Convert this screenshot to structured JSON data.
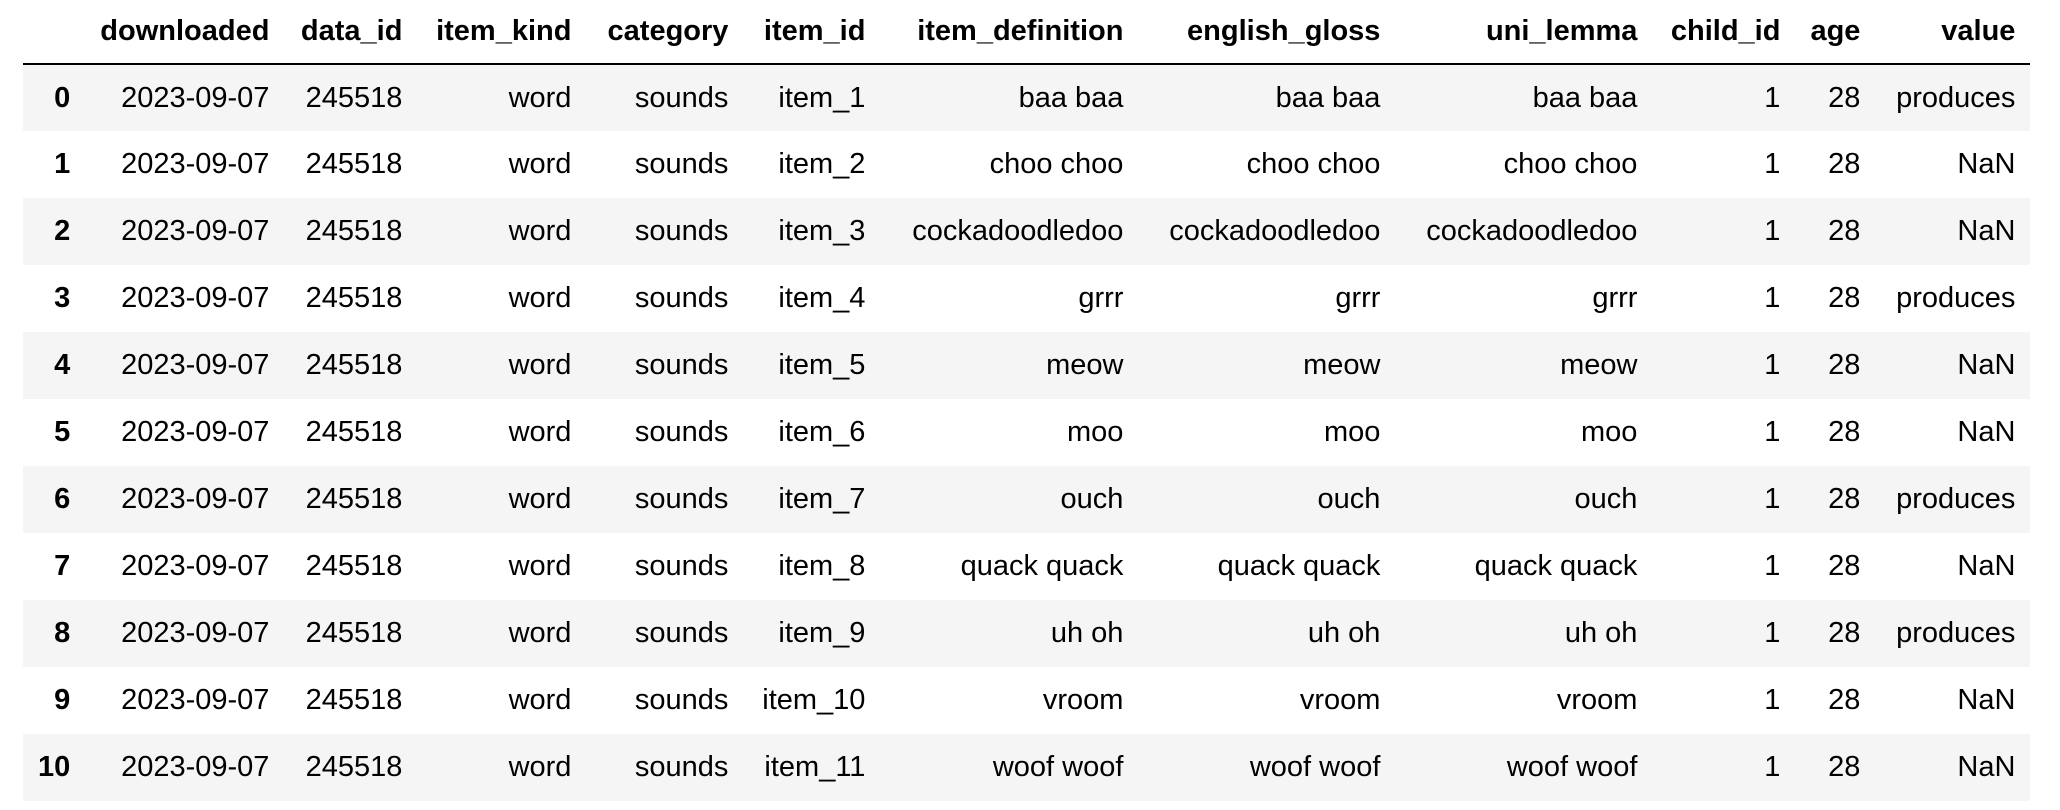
{
  "table": {
    "index_header": "",
    "columns": [
      "downloaded",
      "data_id",
      "item_kind",
      "category",
      "item_id",
      "item_definition",
      "english_gloss",
      "uni_lemma",
      "child_id",
      "age",
      "value"
    ],
    "rows": [
      {
        "index": "0",
        "cells": [
          "2023-09-07",
          "245518",
          "word",
          "sounds",
          "item_1",
          "baa baa",
          "baa baa",
          "baa baa",
          "1",
          "28",
          "produces"
        ]
      },
      {
        "index": "1",
        "cells": [
          "2023-09-07",
          "245518",
          "word",
          "sounds",
          "item_2",
          "choo choo",
          "choo choo",
          "choo choo",
          "1",
          "28",
          "NaN"
        ]
      },
      {
        "index": "2",
        "cells": [
          "2023-09-07",
          "245518",
          "word",
          "sounds",
          "item_3",
          "cockadoodledoo",
          "cockadoodledoo",
          "cockadoodledoo",
          "1",
          "28",
          "NaN"
        ]
      },
      {
        "index": "3",
        "cells": [
          "2023-09-07",
          "245518",
          "word",
          "sounds",
          "item_4",
          "grrr",
          "grrr",
          "grrr",
          "1",
          "28",
          "produces"
        ]
      },
      {
        "index": "4",
        "cells": [
          "2023-09-07",
          "245518",
          "word",
          "sounds",
          "item_5",
          "meow",
          "meow",
          "meow",
          "1",
          "28",
          "NaN"
        ]
      },
      {
        "index": "5",
        "cells": [
          "2023-09-07",
          "245518",
          "word",
          "sounds",
          "item_6",
          "moo",
          "moo",
          "moo",
          "1",
          "28",
          "NaN"
        ]
      },
      {
        "index": "6",
        "cells": [
          "2023-09-07",
          "245518",
          "word",
          "sounds",
          "item_7",
          "ouch",
          "ouch",
          "ouch",
          "1",
          "28",
          "produces"
        ]
      },
      {
        "index": "7",
        "cells": [
          "2023-09-07",
          "245518",
          "word",
          "sounds",
          "item_8",
          "quack quack",
          "quack quack",
          "quack quack",
          "1",
          "28",
          "NaN"
        ]
      },
      {
        "index": "8",
        "cells": [
          "2023-09-07",
          "245518",
          "word",
          "sounds",
          "item_9",
          "uh oh",
          "uh oh",
          "uh oh",
          "1",
          "28",
          "produces"
        ]
      },
      {
        "index": "9",
        "cells": [
          "2023-09-07",
          "245518",
          "word",
          "sounds",
          "item_10",
          "vroom",
          "vroom",
          "vroom",
          "1",
          "28",
          "NaN"
        ]
      },
      {
        "index": "10",
        "cells": [
          "2023-09-07",
          "245518",
          "word",
          "sounds",
          "item_11",
          "woof woof",
          "woof woof",
          "woof woof",
          "1",
          "28",
          "NaN"
        ]
      }
    ]
  },
  "colors": {
    "striped_row_background": "#f5f5f5",
    "row_background": "#ffffff",
    "header_rule": "#000000",
    "text": "#000000"
  }
}
